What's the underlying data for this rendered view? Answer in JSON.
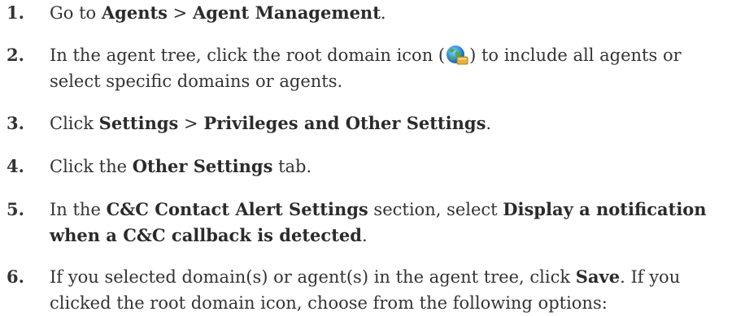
{
  "steps": [
    {
      "number": "1.",
      "parts": [
        "Go to ",
        "Agents",
        " > ",
        "Agent Management",
        "."
      ]
    },
    {
      "number": "2.",
      "parts": [
        "In the agent tree, click the root domain icon (",
        ") to include all agents or",
        "select specific domains or agents."
      ]
    },
    {
      "number": "3.",
      "parts": [
        "Click ",
        "Settings",
        " > ",
        "Privileges and Other Settings",
        "."
      ]
    },
    {
      "number": "4.",
      "parts": [
        "Click the ",
        "Other Settings",
        " tab."
      ]
    },
    {
      "number": "5.",
      "parts": [
        "In the ",
        "C&C Contact Alert Settings",
        " section, select ",
        "Display a notification",
        "when a C&C callback is detected",
        "."
      ]
    },
    {
      "number": "6.",
      "parts": [
        "If you selected domain(s) or agent(s) in the agent tree, click ",
        "Save",
        ". If you",
        "clicked the root domain icon, choose from the following options:"
      ]
    }
  ],
  "icons": {
    "root_domain": "root-domain-globe-icon"
  }
}
